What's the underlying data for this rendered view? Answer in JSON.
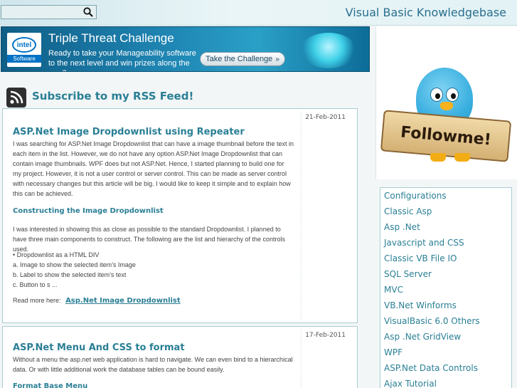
{
  "header": {
    "search_placeholder": "",
    "site_title": "Visual Basic Knowledgebase"
  },
  "banner": {
    "logo_brand": "intel",
    "logo_sub": "Software",
    "title": "Triple Threat Challenge",
    "subtitle": "Ready to take your Manageability software to the next level and win prizes along the way?",
    "button_label": "Take the Challenge"
  },
  "rss": {
    "label": "Subscribe to my RSS Feed!"
  },
  "posts": [
    {
      "date": "21-Feb-2011",
      "title": "ASP.Net Image Dropdownlist using Repeater",
      "intro": "I was searching for ASP.Net Image Dropdownlist that can have a image thumbnail before the text in each item in the list. However, we do not have any option ASP.Net Image Dropdownlist that can contain image thumbnails. WPF does but not ASP.Net. Hence, I started planning to build one for my project. However, it is not a user control or server control. This can be made as server control with necessary changes but this article will be big. I would like to keep it simple and to explain how this can be achieved.",
      "subheading": "Constructing the Image Dropdownlist",
      "para2": " I was interested in showing this as close as possible to the standard Dropdownlist. I planned to have three main components to construct. The following are the list and hierarchy of the controls used.",
      "list": [
        "• Dropdownlist as a HTML DIV",
        "a. Image to show the selected item’s Image",
        "b. Label to show the selected item’s text",
        "c. Button to s ..."
      ],
      "read_more_label": "Read more here:",
      "read_more_link": "Asp.Net Image Dropdownlist"
    },
    {
      "date": "17-Feb-2011",
      "title": "ASP.Net Menu And CSS to format",
      "intro": "Without a menu the asp.net web application is hard to navigate. We can even bind to a hierarchical data. Or with little additional work the database tables can be bound easily.",
      "subheading": "Format Base Menu"
    }
  ],
  "sidebar": {
    "follow_label": "Followme!",
    "categories": [
      "Configurations",
      "Classic Asp",
      "Asp .Net",
      "Javascript and CSS",
      "Classic VB File IO",
      "SQL Server",
      "MVC",
      "VB.Net Winforms",
      "VisualBasic 6.0 Others",
      "Asp .Net GridView",
      "WPF",
      "ASP.Net Data Controls",
      "Ajax Tutorial"
    ]
  },
  "colors": {
    "accent": "#2a7f95",
    "title_blue": "#2a6f8f",
    "border": "#a8ced6"
  }
}
